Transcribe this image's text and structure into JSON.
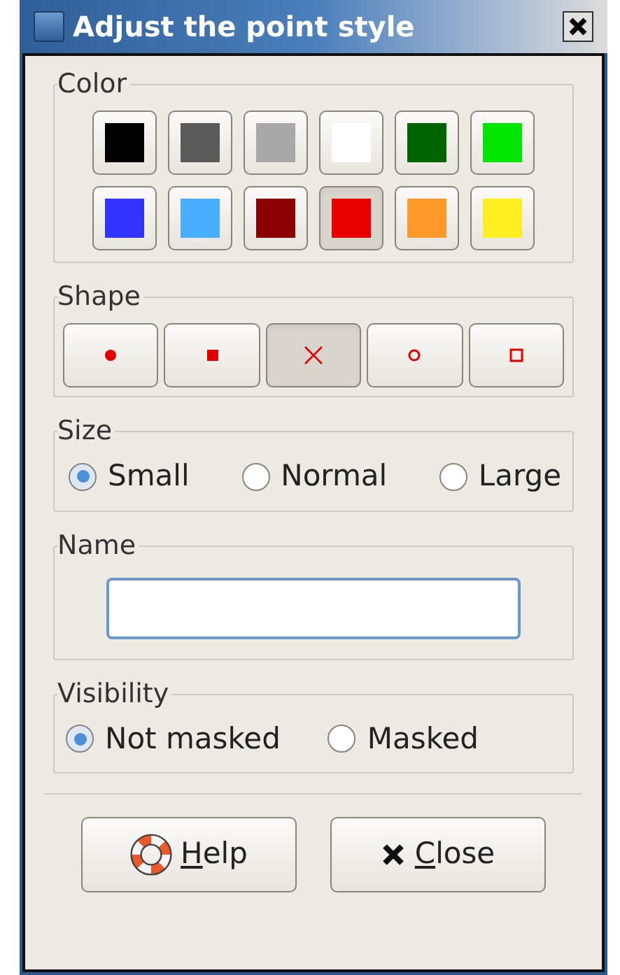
{
  "window": {
    "title": "Adjust the point style"
  },
  "color": {
    "label": "Color",
    "swatches": [
      {
        "color": "#000000",
        "selected": false
      },
      {
        "color": "#5a5a5a",
        "selected": false
      },
      {
        "color": "#a8a8a8",
        "selected": false
      },
      {
        "color": "#ffffff",
        "selected": false
      },
      {
        "color": "#006400",
        "selected": false
      },
      {
        "color": "#00e600",
        "selected": false
      },
      {
        "color": "#3333ff",
        "selected": false
      },
      {
        "color": "#4aaeff",
        "selected": false
      },
      {
        "color": "#8b0000",
        "selected": false
      },
      {
        "color": "#e80000",
        "selected": true
      },
      {
        "color": "#ff9a2a",
        "selected": false
      },
      {
        "color": "#ffee22",
        "selected": false
      }
    ]
  },
  "shape": {
    "label": "Shape",
    "options": [
      {
        "kind": "dot",
        "selected": false
      },
      {
        "kind": "square",
        "selected": false
      },
      {
        "kind": "cross",
        "selected": true
      },
      {
        "kind": "circle",
        "selected": false
      },
      {
        "kind": "open-square",
        "selected": false
      }
    ]
  },
  "size": {
    "label": "Size",
    "options": [
      {
        "label": "Small",
        "selected": true
      },
      {
        "label": "Normal",
        "selected": false
      },
      {
        "label": "Large",
        "selected": false
      }
    ]
  },
  "name": {
    "label": "Name"
  },
  "visibility": {
    "label": "Visibility",
    "options": [
      {
        "label": "Not masked",
        "selected": true
      },
      {
        "label": "Masked",
        "selected": false
      }
    ]
  },
  "buttons": [
    {
      "kind": "help",
      "mnemonic": "H",
      "rest": "elp"
    },
    {
      "kind": "close",
      "mnemonic": "C",
      "rest": "lose"
    }
  ]
}
